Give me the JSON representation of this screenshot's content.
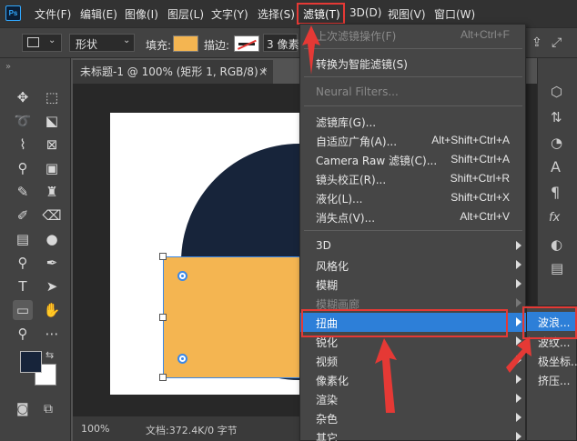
{
  "menubar": {
    "logo": "Ps",
    "items": [
      "文件(F)",
      "编辑(E)",
      "图像(I)",
      "图层(L)",
      "文字(Y)",
      "选择(S)",
      "滤镜(T)",
      "3D(D)",
      "视图(V)",
      "窗口(W)"
    ]
  },
  "options": {
    "shape_mode": "形状",
    "fill_label": "填充:",
    "stroke_label": "描边:",
    "stroke_size": "3 像素",
    "fill_color": "#f4b551"
  },
  "document": {
    "tab_title": "未标题-1 @ 100% (矩形 1, RGB/8) *",
    "close": "×"
  },
  "status": {
    "zoom": "100%",
    "doc_info": "文档:372.4K/0 字节"
  },
  "filter_menu": {
    "items": [
      {
        "label": "上次滤镜操作(F)",
        "shortcut": "Alt+Ctrl+F"
      },
      {
        "label": "转换为智能滤镜(S)"
      },
      {
        "label": "Neural Filters..."
      },
      {
        "label": "滤镜库(G)..."
      },
      {
        "label": "自适应广角(A)...",
        "shortcut": "Alt+Shift+Ctrl+A"
      },
      {
        "label": "Camera Raw 滤镜(C)...",
        "shortcut": "Shift+Ctrl+A"
      },
      {
        "label": "镜头校正(R)...",
        "shortcut": "Shift+Ctrl+R"
      },
      {
        "label": "液化(L)...",
        "shortcut": "Shift+Ctrl+X"
      },
      {
        "label": "消失点(V)...",
        "shortcut": "Alt+Ctrl+V"
      },
      {
        "label": "3D"
      },
      {
        "label": "风格化"
      },
      {
        "label": "模糊"
      },
      {
        "label": "模糊画廊"
      },
      {
        "label": "扭曲"
      },
      {
        "label": "锐化"
      },
      {
        "label": "视频"
      },
      {
        "label": "像素化"
      },
      {
        "label": "渲染"
      },
      {
        "label": "杂色"
      },
      {
        "label": "其它"
      }
    ]
  },
  "distort_submenu": {
    "items": [
      "波浪...",
      "波纹...",
      "极坐标...",
      "挤压..."
    ]
  }
}
